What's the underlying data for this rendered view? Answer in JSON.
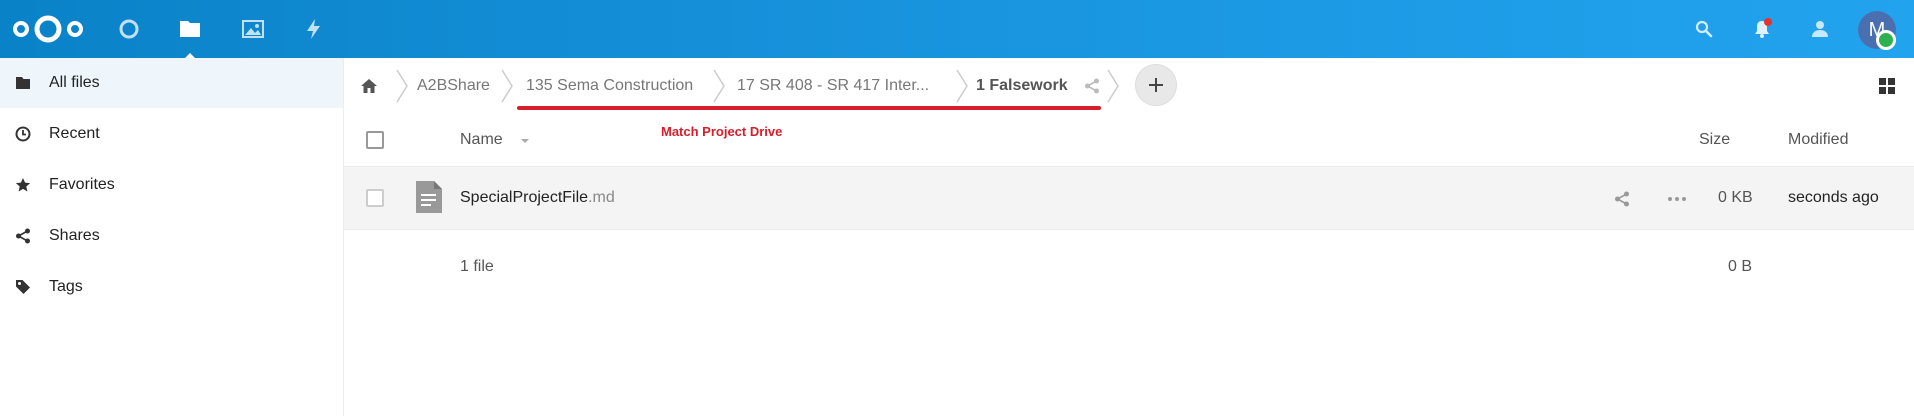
{
  "header": {
    "apps": [
      {
        "name": "dashboard",
        "icon": "circle-icon"
      },
      {
        "name": "files",
        "icon": "folder-icon"
      },
      {
        "name": "photos",
        "icon": "image-icon"
      },
      {
        "name": "activity",
        "icon": "lightning-icon"
      }
    ],
    "avatar_letter": "M",
    "colors": {
      "header_start": "#0a82c8",
      "header_end": "#22a3ee",
      "notification": "#e9322d",
      "status_online": "#2fb14f",
      "annotation": "#d61f2a"
    }
  },
  "sidebar": {
    "items": [
      {
        "label": "All files",
        "icon": "folder-icon"
      },
      {
        "label": "Recent",
        "icon": "clock-icon"
      },
      {
        "label": "Favorites",
        "icon": "star-icon"
      },
      {
        "label": "Shares",
        "icon": "share-icon"
      },
      {
        "label": "Tags",
        "icon": "tag-icon"
      }
    ]
  },
  "breadcrumb": {
    "items": [
      "A2BShare",
      "135 Sema Construction",
      "17 SR 408 - SR 417 Inter...",
      "1 Falsework"
    ]
  },
  "annotation": {
    "label": "Match Project Drive"
  },
  "table": {
    "headers": {
      "name": "Name",
      "size": "Size",
      "modified": "Modified"
    },
    "rows": [
      {
        "basename": "SpecialProjectFile",
        "extension": ".md",
        "size": "0 KB",
        "modified": "seconds ago",
        "icon": "text-file-icon"
      }
    ],
    "summary": {
      "count": "1 file",
      "size": "0 B"
    }
  }
}
